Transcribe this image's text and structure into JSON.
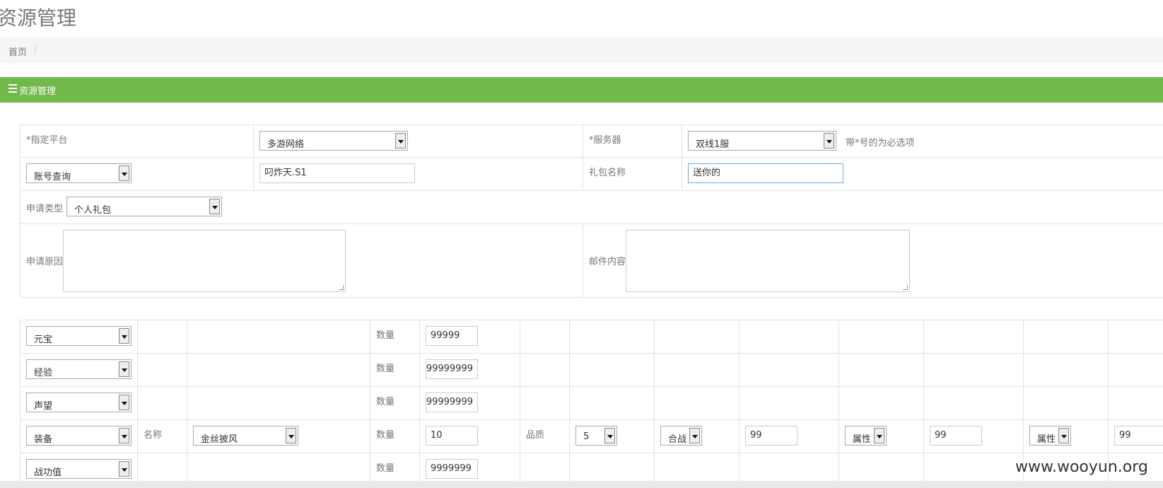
{
  "page": {
    "title": "资源管理"
  },
  "breadcrumb": {
    "home": "首页",
    "separator": "/"
  },
  "section": {
    "title": "资源管理"
  },
  "form": {
    "platform_label": "*指定平台",
    "platform_value": "多游网络",
    "server_label": "*服务器",
    "server_value": "双线1服",
    "required_hint": "带*号的为必选项",
    "account_query_value": "账号查询",
    "account_input_value": "叼炸天.S1",
    "gift_name_label": "礼包名称",
    "gift_name_value": "送你的",
    "apply_type_label": "申请类型",
    "apply_type_value": "个人礼包",
    "reason_label": "申请原因",
    "mail_content_label": "邮件内容"
  },
  "items": {
    "quantity_label": "数量",
    "name_label": "名称",
    "quality_label": "品质",
    "rows": [
      {
        "type": "元宝",
        "quantity": "99999"
      },
      {
        "type": "经验",
        "quantity": "99999999"
      },
      {
        "type": "声望",
        "quantity": "99999999"
      },
      {
        "type": "装备",
        "name": "金丝披风",
        "quantity": "10",
        "quality": "5",
        "combine": "合战",
        "combine_value": "99",
        "attr1": "属性",
        "attr1_value": "99",
        "attr2": "属性",
        "attr2_value": "99"
      },
      {
        "type": "战功值",
        "quantity": "9999999"
      }
    ]
  },
  "watermark": "www.wooyun.org",
  "colors": {
    "section_bar": "#72b84a",
    "breadcrumb_bg": "#f5f5f5",
    "focus_border": "#66afe9"
  }
}
